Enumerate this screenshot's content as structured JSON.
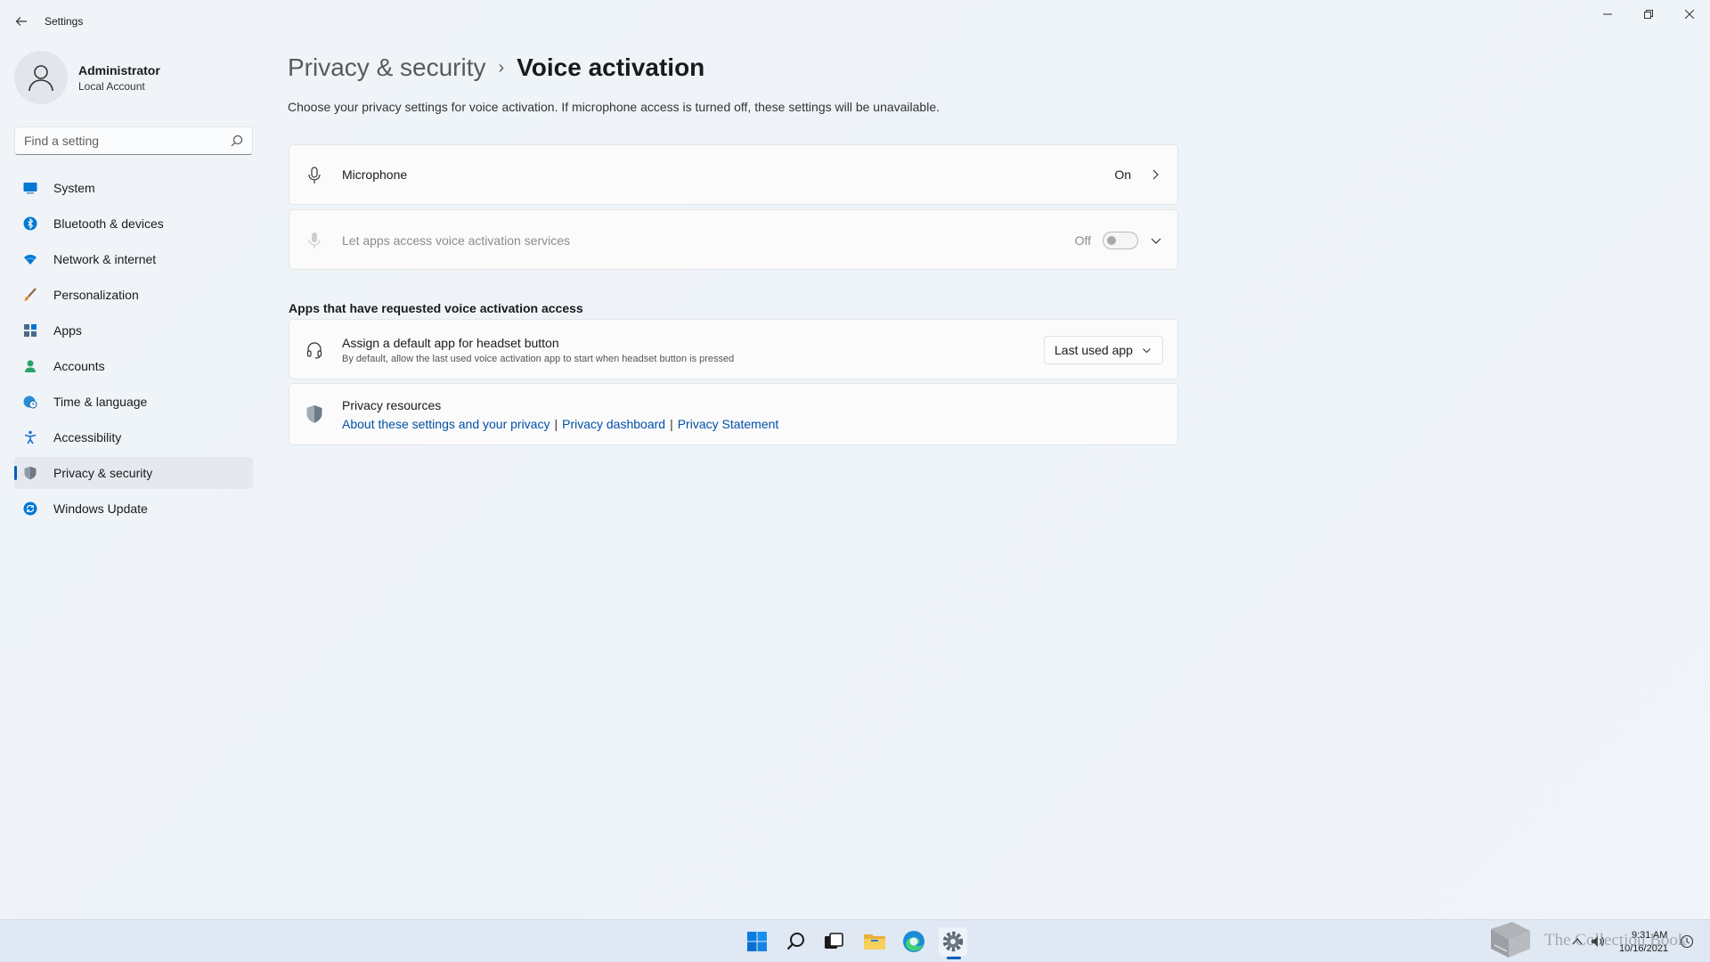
{
  "window": {
    "title": "Settings",
    "controls": [
      "minimize",
      "maximize",
      "close"
    ]
  },
  "profile": {
    "name": "Administrator",
    "account_type": "Local Account"
  },
  "search": {
    "placeholder": "Find a setting"
  },
  "sidebar": {
    "items": [
      {
        "label": "System",
        "icon": "system-icon",
        "color": "#0078d4"
      },
      {
        "label": "Bluetooth & devices",
        "icon": "bluetooth-icon",
        "color": "#0078d4"
      },
      {
        "label": "Network & internet",
        "icon": "wifi-icon",
        "color": "#0078d4"
      },
      {
        "label": "Personalization",
        "icon": "brush-icon",
        "color": "#e08b2f"
      },
      {
        "label": "Apps",
        "icon": "apps-icon",
        "color": "#4a6a8a"
      },
      {
        "label": "Accounts",
        "icon": "person-icon",
        "color": "#2aa36b"
      },
      {
        "label": "Time & language",
        "icon": "globe-clock-icon",
        "color": "#0078d4"
      },
      {
        "label": "Accessibility",
        "icon": "accessibility-icon",
        "color": "#1a6fd6"
      },
      {
        "label": "Privacy & security",
        "icon": "shield-icon",
        "color": "#6e7a86",
        "selected": true
      },
      {
        "label": "Windows Update",
        "icon": "update-icon",
        "color": "#0078d4"
      }
    ]
  },
  "header": {
    "breadcrumb_parent": "Privacy & security",
    "breadcrumb_separator": "›",
    "page_title": "Voice activation",
    "description": "Choose your privacy settings for voice activation. If microphone access is turned off, these settings will be unavailable."
  },
  "microphone": {
    "label": "Microphone",
    "value": "On"
  },
  "voice_services": {
    "label": "Let apps access voice activation services",
    "state_label": "Off",
    "enabled": false
  },
  "section": {
    "heading": "Apps that have requested voice activation access"
  },
  "headset": {
    "title": "Assign a default app for headset button",
    "subtitle": "By default, allow the last used voice activation app to start when headset button is pressed",
    "selected_option": "Last used app"
  },
  "privacy_resources": {
    "title": "Privacy resources",
    "links": [
      "About these settings and your privacy",
      "Privacy dashboard",
      "Privacy Statement"
    ],
    "separator": "|"
  },
  "taskbar": {
    "apps": [
      "windows-start-icon",
      "search-icon",
      "task-view-icon",
      "file-explorer-icon",
      "edge-icon",
      "settings-gear-icon"
    ],
    "clock_time": "9:31 AM",
    "clock_date": "10/16/2021"
  },
  "watermark": {
    "text": "The Collection Book"
  },
  "colors": {
    "accent": "#005fb8",
    "link": "#0050a5",
    "background": "#eef3f9"
  }
}
